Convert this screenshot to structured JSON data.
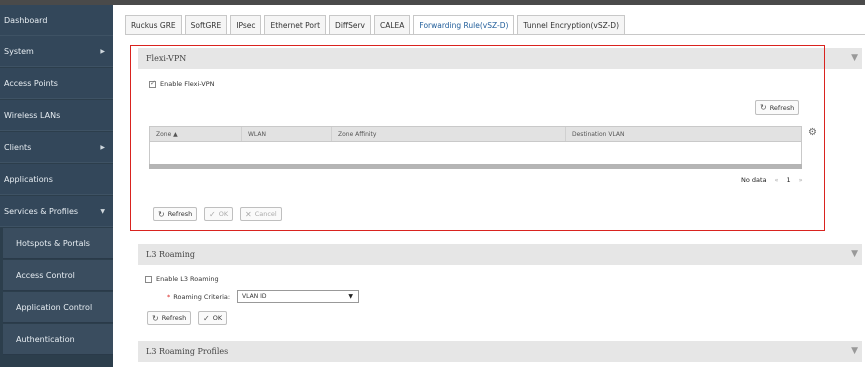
{
  "sidebar": {
    "items": [
      {
        "label": "Dashboard"
      },
      {
        "label": "System",
        "chevron": "▶"
      },
      {
        "label": "Access Points"
      },
      {
        "label": "Wireless LANs"
      },
      {
        "label": "Clients",
        "chevron": "▶"
      },
      {
        "label": "Applications"
      },
      {
        "label": "Services & Profiles",
        "chevron": "▼"
      }
    ],
    "subitems": [
      {
        "label": "Hotspots & Portals"
      },
      {
        "label": "Access Control"
      },
      {
        "label": "Application Control"
      },
      {
        "label": "Authentication"
      }
    ]
  },
  "tabs": [
    {
      "label": "Ruckus GRE"
    },
    {
      "label": "SoftGRE"
    },
    {
      "label": "IPsec"
    },
    {
      "label": "Ethernet Port"
    },
    {
      "label": "DiffServ"
    },
    {
      "label": "CALEA"
    },
    {
      "label": "Forwarding Rule(vSZ-D)",
      "active": true
    },
    {
      "label": "Tunnel Encryption(vSZ-D)"
    }
  ],
  "flexi": {
    "title": "Flexi-VPN",
    "enable_label": "Enable Flexi-VPN",
    "enabled": true,
    "refresh_top": "Refresh",
    "columns": [
      "Zone ▲",
      "WLAN",
      "Zone Affinity",
      "Destination VLAN"
    ],
    "no_data": "No data",
    "pager_prev": "«",
    "pager_page": "1",
    "pager_next": "»",
    "refresh": "Refresh",
    "ok": "OK",
    "cancel": "Cancel"
  },
  "l3": {
    "title": "L3 Roaming",
    "enable_label": "Enable L3 Roaming",
    "enabled": false,
    "criteria_label": "Roaming Criteria:",
    "required_mark": "*",
    "criteria_value": "VLAN ID",
    "refresh": "Refresh",
    "ok": "OK"
  },
  "l3profiles": {
    "title": "L3 Roaming Profiles"
  },
  "icons": {
    "collapse": "▼",
    "refresh": "↻",
    "ok": "✓",
    "cancel": "✕",
    "gear": "⚙"
  }
}
